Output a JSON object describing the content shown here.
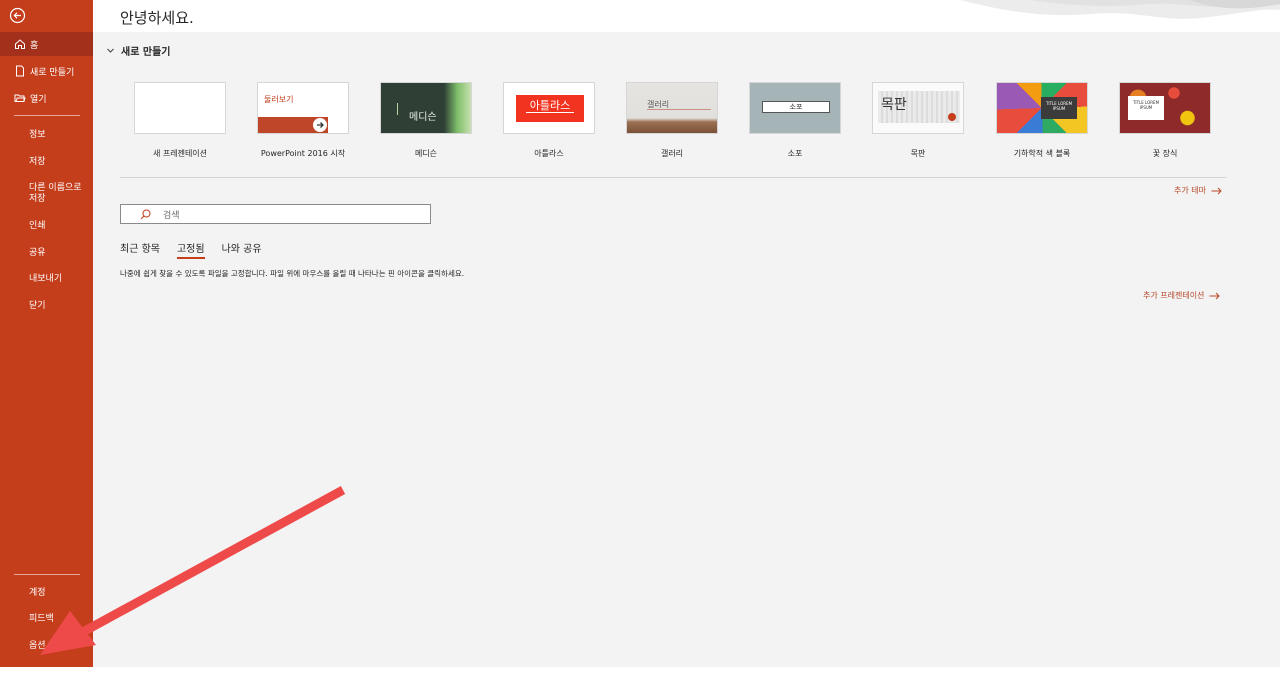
{
  "sidebar": {
    "back_icon": "back-arrow-icon",
    "home": "홈",
    "new": "새로 만들기",
    "open": "열기",
    "info": "정보",
    "save": "저장",
    "save_as": "다른 이름으로 저장",
    "print": "인쇄",
    "share": "공유",
    "export": "내보내기",
    "close": "닫기",
    "account": "계정",
    "feedback": "피드백",
    "options": "옵션"
  },
  "header": {
    "greeting": "안녕하세요."
  },
  "new_section": {
    "heading": "새로 만들기",
    "templates": [
      {
        "label": "새 프레젠테이션",
        "thumb_text": ""
      },
      {
        "label": "PowerPoint 2016 시작",
        "thumb_text": "둘러보기"
      },
      {
        "label": "메디슨",
        "thumb_text": "메디슨"
      },
      {
        "label": "아틀라스",
        "thumb_text": "아틀라스"
      },
      {
        "label": "갤러리",
        "thumb_text": "갤러리"
      },
      {
        "label": "소포",
        "thumb_text": "소포"
      },
      {
        "label": "목판",
        "thumb_text": "목판"
      },
      {
        "label": "기하학적 색 블록",
        "thumb_text": "TITLE LOREM IPSUM"
      },
      {
        "label": "꽃 장식",
        "thumb_text": "TITLE LOREM IPSUM"
      }
    ],
    "more_themes": "추가 테마"
  },
  "search": {
    "placeholder": "검색"
  },
  "tabs": {
    "recent": "최근 항목",
    "pinned": "고정됨",
    "shared": "나와 공유"
  },
  "pinned_hint": "나중에 쉽게 찾을 수 있도록 파일을 고정합니다. 파일 위에 마우스를 올릴 때 나타나는 핀 아이콘을 클릭하세요.",
  "more_presentations": "추가 프레젠테이션",
  "colors": {
    "sidebar": "#c43e1c",
    "sidebar_active": "#a3301a",
    "accent": "#b7472a",
    "annotation_arrow": "#ef4a4a"
  }
}
